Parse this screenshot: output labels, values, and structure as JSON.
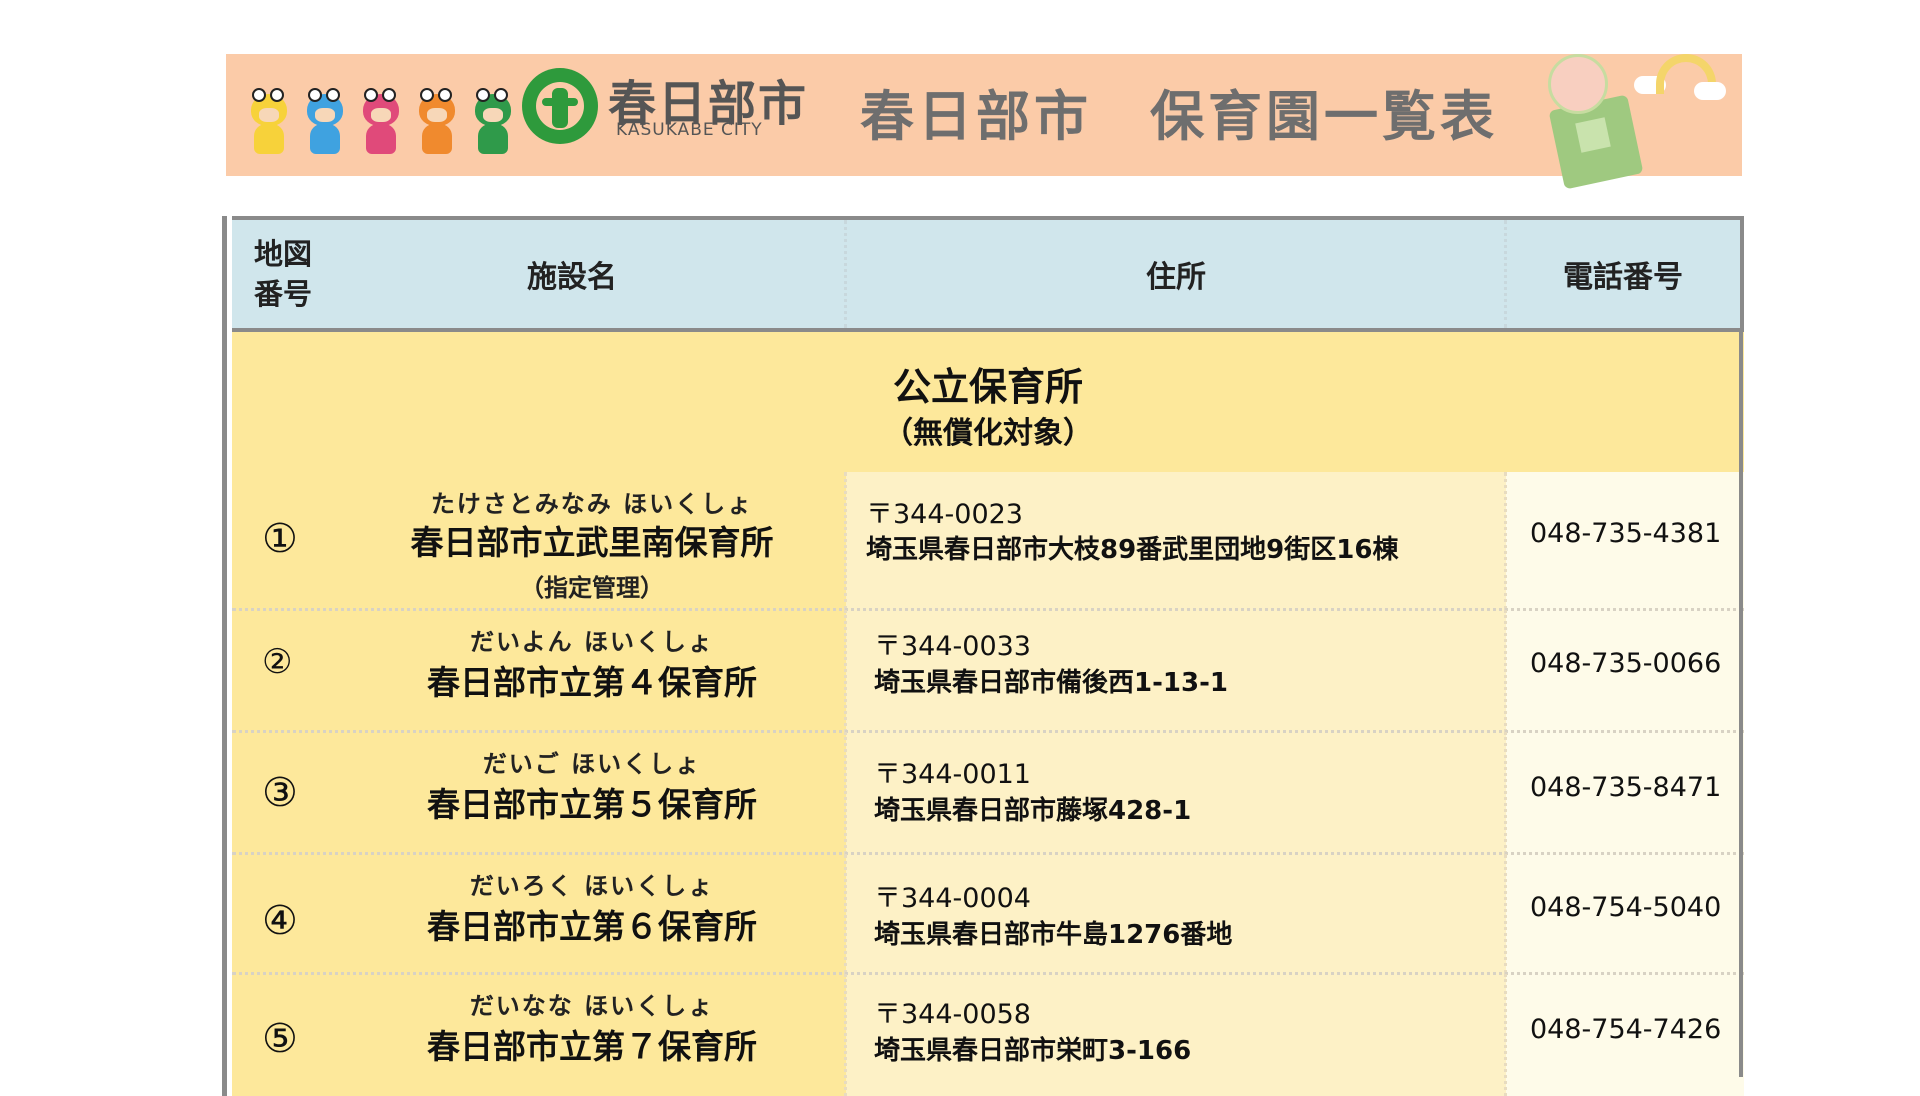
{
  "banner": {
    "city_name": "春日部市",
    "city_name_en": "KASUKABE CITY",
    "title": "春日部市　保育園一覧表",
    "colors": {
      "background": "#fbcba8",
      "logo_green": "#2e9a3c"
    }
  },
  "table": {
    "headers": {
      "map_number": "地図\n番号",
      "facility": "施設名",
      "address": "住所",
      "phone": "電話番号"
    },
    "section": {
      "title": "公立保育所",
      "subtitle": "（無償化対象）"
    },
    "rows": [
      {
        "num": "①",
        "ruby": "たけさとみなみ ほいくしょ",
        "name": "春日部市立武里南保育所",
        "note": "（指定管理）",
        "zip": "〒344-0023",
        "address": "埼玉県春日部市大枝89番武里団地9街区16棟",
        "phone": "048-735-4381"
      },
      {
        "num": "②",
        "ruby": "だいよん ほいくしょ",
        "name": "春日部市立第４保育所",
        "note": "",
        "zip": "〒344-0033",
        "address": "埼玉県春日部市備後西1-13-1",
        "phone": "048-735-0066"
      },
      {
        "num": "③",
        "ruby": "だいご ほいくしょ",
        "name": "春日部市立第５保育所",
        "note": "",
        "zip": "〒344-0011",
        "address": "埼玉県春日部市藤塚428-1",
        "phone": "048-735-8471"
      },
      {
        "num": "④",
        "ruby": "だいろく ほいくしょ",
        "name": "春日部市立第６保育所",
        "note": "",
        "zip": "〒344-0004",
        "address": "埼玉県春日部市牛島1276番地",
        "phone": "048-754-5040"
      },
      {
        "num": "⑤",
        "ruby": "だいなな ほいくしょ",
        "name": "春日部市立第７保育所",
        "note": "",
        "zip": "〒344-0058",
        "address": "埼玉県春日部市栄町3-166",
        "phone": "048-754-7426"
      }
    ]
  }
}
